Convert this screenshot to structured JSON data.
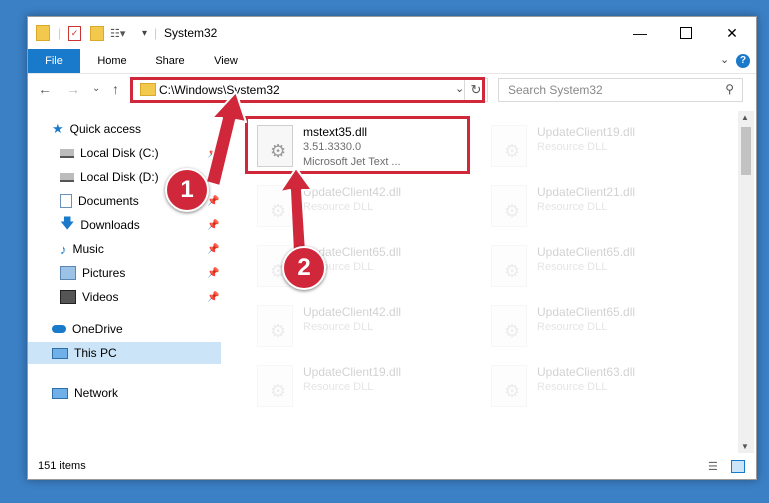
{
  "window": {
    "title": "System32"
  },
  "ribbon": {
    "tabs": [
      "File",
      "Home",
      "Share",
      "View"
    ]
  },
  "address": {
    "path": "C:\\Windows\\System32"
  },
  "search": {
    "placeholder": "Search System32"
  },
  "nav": [
    {
      "label": "Quick access",
      "icon": "star-icon"
    },
    {
      "label": "Local Disk (C:)",
      "icon": "drive-icon",
      "pinned": true
    },
    {
      "label": "Local Disk (D:)",
      "icon": "drive-icon",
      "pinned": true
    },
    {
      "label": "Documents",
      "icon": "documents-icon",
      "pinned": true
    },
    {
      "label": "Downloads",
      "icon": "download-icon",
      "pinned": true
    },
    {
      "label": "Music",
      "icon": "music-icon",
      "pinned": true
    },
    {
      "label": "Pictures",
      "icon": "pictures-icon",
      "pinned": true
    },
    {
      "label": "Videos",
      "icon": "videos-icon",
      "pinned": true
    },
    {
      "label": "OneDrive",
      "icon": "cloud-icon"
    },
    {
      "label": "This PC",
      "icon": "computer-icon",
      "selected": true
    },
    {
      "label": "Network",
      "icon": "network-icon"
    }
  ],
  "files": [
    {
      "name": "mstext35.dll",
      "line1": "3.51.3330.0",
      "line2": "Microsoft Jet Text ..."
    },
    {
      "name": "UpdateClient19.dll",
      "line1": "Resource DLL"
    },
    {
      "name": "UpdateClient42.dll",
      "line1": "Resource DLL"
    },
    {
      "name": "UpdateClient21.dll",
      "line1": "Resource DLL"
    },
    {
      "name": "UpdateClient65.dll",
      "line1": "Resource DLL"
    },
    {
      "name": "UpdateClient65.dll",
      "line1": "Resource DLL"
    },
    {
      "name": "UpdateClient42.dll",
      "line1": "Resource DLL"
    },
    {
      "name": "UpdateClient65.dll",
      "line1": "Resource DLL"
    },
    {
      "name": "UpdateClient19.dll",
      "line1": "Resource DLL"
    },
    {
      "name": "UpdateClient63.dll",
      "line1": "Resource DLL"
    }
  ],
  "status": {
    "count": "151 items"
  },
  "annotations": {
    "step1": "1",
    "step2": "2"
  },
  "colors": {
    "accent": "#1979ca",
    "highlight": "#d0283a",
    "selected": "#cce4f7"
  }
}
